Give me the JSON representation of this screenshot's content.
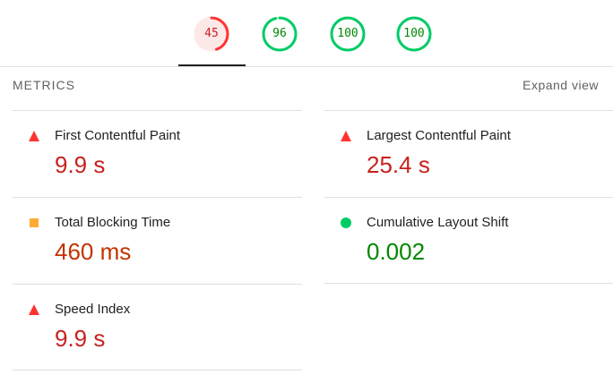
{
  "gauges": [
    {
      "score": "45",
      "value": 45,
      "rating": "fail",
      "color": "#f33"
    },
    {
      "score": "96",
      "value": 96,
      "rating": "pass",
      "color": "#0c6"
    },
    {
      "score": "100",
      "value": 100,
      "rating": "pass",
      "color": "#0c6"
    },
    {
      "score": "100",
      "value": 100,
      "rating": "pass",
      "color": "#0c6"
    }
  ],
  "metrics_header": {
    "title": "METRICS",
    "expand_label": "Expand view"
  },
  "metrics": [
    {
      "label": "First Contentful Paint",
      "value": "9.9 s",
      "rating": "fail",
      "icon": "red-triangle-icon"
    },
    {
      "label": "Largest Contentful Paint",
      "value": "25.4 s",
      "rating": "fail",
      "icon": "red-triangle-icon"
    },
    {
      "label": "Total Blocking Time",
      "value": "460 ms",
      "rating": "average",
      "icon": "orange-square-icon"
    },
    {
      "label": "Cumulative Layout Shift",
      "value": "0.002",
      "rating": "pass",
      "icon": "green-circle-icon"
    },
    {
      "label": "Speed Index",
      "value": "9.9 s",
      "rating": "fail",
      "icon": "red-triangle-icon"
    }
  ],
  "colors": {
    "fail": "#f33",
    "average": "#fa3",
    "pass": "#0c6",
    "fail_text": "#c7221f",
    "average_text": "#c33300",
    "pass_text": "#008800"
  }
}
